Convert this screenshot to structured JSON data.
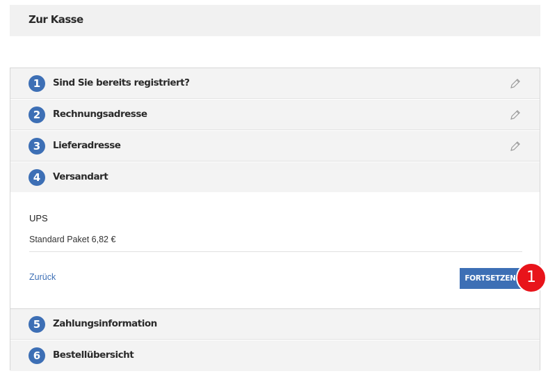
{
  "header": {
    "title": "Zur Kasse"
  },
  "steps": [
    {
      "number": "1",
      "title": "Sind Sie bereits registriert?",
      "edit_icon": "pencil-icon"
    },
    {
      "number": "2",
      "title": "Rechnungsadresse",
      "edit_icon": "pencil-icon"
    },
    {
      "number": "3",
      "title": "Lieferadresse",
      "edit_icon": "pencil-icon"
    },
    {
      "number": "4",
      "title": "Versandart"
    },
    {
      "number": "5",
      "title": "Zahlungsinformation"
    },
    {
      "number": "6",
      "title": "Bestellübersicht"
    }
  ],
  "shipping": {
    "carrier": "UPS",
    "option": "Standard Paket 6,82 €",
    "back_label": "Zurück",
    "continue_label": "FORTSETZEN"
  },
  "annotation": {
    "badge": "1"
  },
  "colors": {
    "accent": "#3d6fb5",
    "step_bg": "#f3f3f3",
    "badge": "#e8141b"
  }
}
